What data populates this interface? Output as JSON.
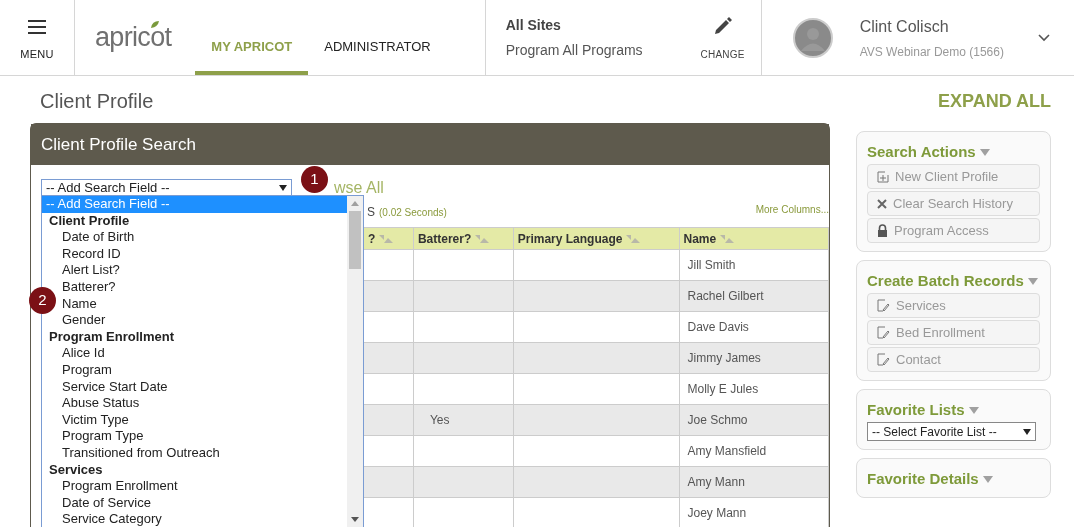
{
  "header": {
    "menu_label": "MENU",
    "logo": "apricot",
    "tabs": [
      {
        "label": "MY APRICOT",
        "selected": true
      },
      {
        "label": "ADMINISTRATOR",
        "selected": false
      }
    ],
    "site": {
      "title": "All Sites",
      "program": "Program All Programs"
    },
    "change_label": "CHANGE",
    "user": {
      "name": "Clint Colisch",
      "org": "AVS Webinar Demo (1566)"
    }
  },
  "page_title": "Client Profile",
  "expand_all": "EXPAND ALL",
  "search_panel": {
    "title": "Client Profile Search",
    "select_value": "-- Add Search Field --",
    "browse_all": "wse All",
    "results_label": "S",
    "results_time": "(0.02 Seconds)",
    "more_columns": "More Columns...",
    "dropdown": [
      {
        "kind": "option",
        "label": "-- Add Search Field --",
        "selected": true
      },
      {
        "kind": "group",
        "label": "Client Profile"
      },
      {
        "kind": "option",
        "label": "Date of Birth",
        "selected": false
      },
      {
        "kind": "option",
        "label": "Record ID",
        "selected": false
      },
      {
        "kind": "option",
        "label": "Alert List?",
        "selected": false
      },
      {
        "kind": "option",
        "label": "Batterer?",
        "selected": false
      },
      {
        "kind": "option",
        "label": "Name",
        "selected": false
      },
      {
        "kind": "option",
        "label": "Gender",
        "selected": false
      },
      {
        "kind": "group",
        "label": "Program Enrollment"
      },
      {
        "kind": "option",
        "label": "Alice Id",
        "selected": false
      },
      {
        "kind": "option",
        "label": "Program",
        "selected": false
      },
      {
        "kind": "option",
        "label": "Service Start Date",
        "selected": false
      },
      {
        "kind": "option",
        "label": "Abuse Status",
        "selected": false
      },
      {
        "kind": "option",
        "label": "Victim Type",
        "selected": false
      },
      {
        "kind": "option",
        "label": "Program Type",
        "selected": false
      },
      {
        "kind": "option",
        "label": "Transitioned from Outreach",
        "selected": false
      },
      {
        "kind": "group",
        "label": "Services"
      },
      {
        "kind": "option",
        "label": "Program Enrollment",
        "selected": false
      },
      {
        "kind": "option",
        "label": "Date of Service",
        "selected": false
      },
      {
        "kind": "option",
        "label": "Service Category",
        "selected": false
      }
    ],
    "callouts": [
      "1",
      "2"
    ],
    "table": {
      "columns": [
        "?",
        "Batterer?",
        "Primary Language",
        "Name"
      ],
      "rows": [
        {
          "name": "Jill Smith"
        },
        {
          "name": "Rachel Gilbert"
        },
        {
          "name": "Dave Davis"
        },
        {
          "name": "Jimmy James"
        },
        {
          "name": "Molly E Jules"
        },
        {
          "batterer": "Yes",
          "name": "Joe Schmo"
        },
        {
          "name": "Amy Mansfield"
        },
        {
          "name": "Amy Mann"
        },
        {
          "name": "Joey Mann"
        }
      ]
    }
  },
  "sidebar": [
    {
      "title": "Search Actions",
      "buttons": [
        {
          "kind": "add",
          "label": "New Client Profile"
        },
        {
          "kind": "clear",
          "label": "Clear Search History"
        },
        {
          "kind": "lock",
          "label": "Program Access"
        }
      ]
    },
    {
      "title": "Create Batch Records",
      "buttons": [
        {
          "kind": "edit",
          "label": "Services"
        },
        {
          "kind": "edit",
          "label": "Bed Enrollment"
        },
        {
          "kind": "edit",
          "label": "Contact"
        }
      ]
    },
    {
      "title": "Favorite Lists",
      "select_value": "-- Select Favorite List --"
    },
    {
      "title": "Favorite Details"
    }
  ]
}
